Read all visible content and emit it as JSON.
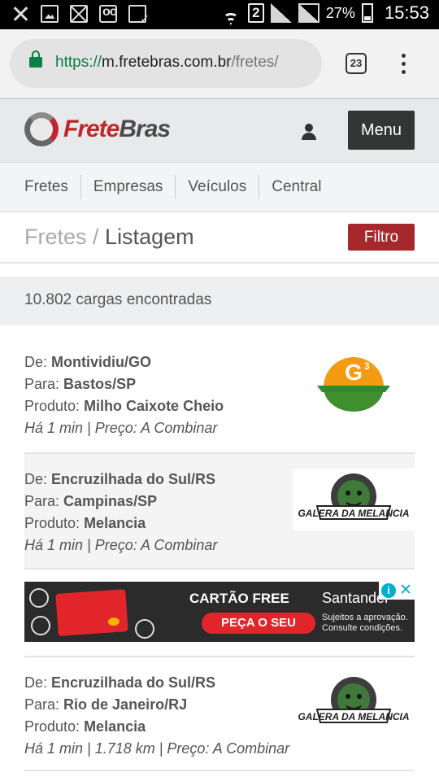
{
  "status_bar": {
    "sim_slot": "2",
    "battery": "27%",
    "time": "15:53"
  },
  "browser": {
    "url_scheme": "https://",
    "url_host": "m.fretebras.com.br",
    "url_path": "/fretes/",
    "tab_count": "23"
  },
  "header": {
    "logo_part1": "Frete",
    "logo_part2": "Bras",
    "menu_label": "Menu"
  },
  "nav": {
    "items": [
      "Fretes",
      "Empresas",
      "Veículos",
      "Central"
    ]
  },
  "page": {
    "crumb_parent": "Fretes /",
    "crumb_current": "Listagem",
    "filter_label": "Filtro",
    "results_count": "10.802 cargas encontradas"
  },
  "listings": [
    {
      "from_label": "De:",
      "from": "Montividiu/GO",
      "to_label": "Para:",
      "to": "Bastos/SP",
      "product_label": "Produto:",
      "product": "Milho Caixote Cheio",
      "meta": "Há 1 min | Preço: A Combinar",
      "thumb": "g3-logo"
    },
    {
      "from_label": "De:",
      "from": "Encruzilhada do Sul/RS",
      "to_label": "Para:",
      "to": "Campinas/SP",
      "product_label": "Produto:",
      "product": "Melancia",
      "meta": "Há 1 min | Preço: A Combinar",
      "thumb": "galera-da-melancia-logo",
      "thumb_text": "GALERA DA MELANCIA"
    },
    {
      "from_label": "De:",
      "from": "Encruzilhada do Sul/RS",
      "to_label": "Para:",
      "to": "Rio de Janeiro/RJ",
      "product_label": "Produto:",
      "product": "Melancia",
      "meta": "Há 1 min | 1.718 km | Preço: A Combinar",
      "thumb": "galera-da-melancia-logo",
      "thumb_text": "GALERA DA MELANCIA"
    }
  ],
  "ad": {
    "title": "CARTÃO FREE",
    "cta": "PEÇA O SEU",
    "brand": "Santander",
    "subtext": "Sujeitos a aprovação. Consulte condições."
  },
  "colors": {
    "brand_red": "#c0272d",
    "filter_red": "#a6272c",
    "menu_dark": "#333634",
    "lock_green": "#0b8043"
  }
}
